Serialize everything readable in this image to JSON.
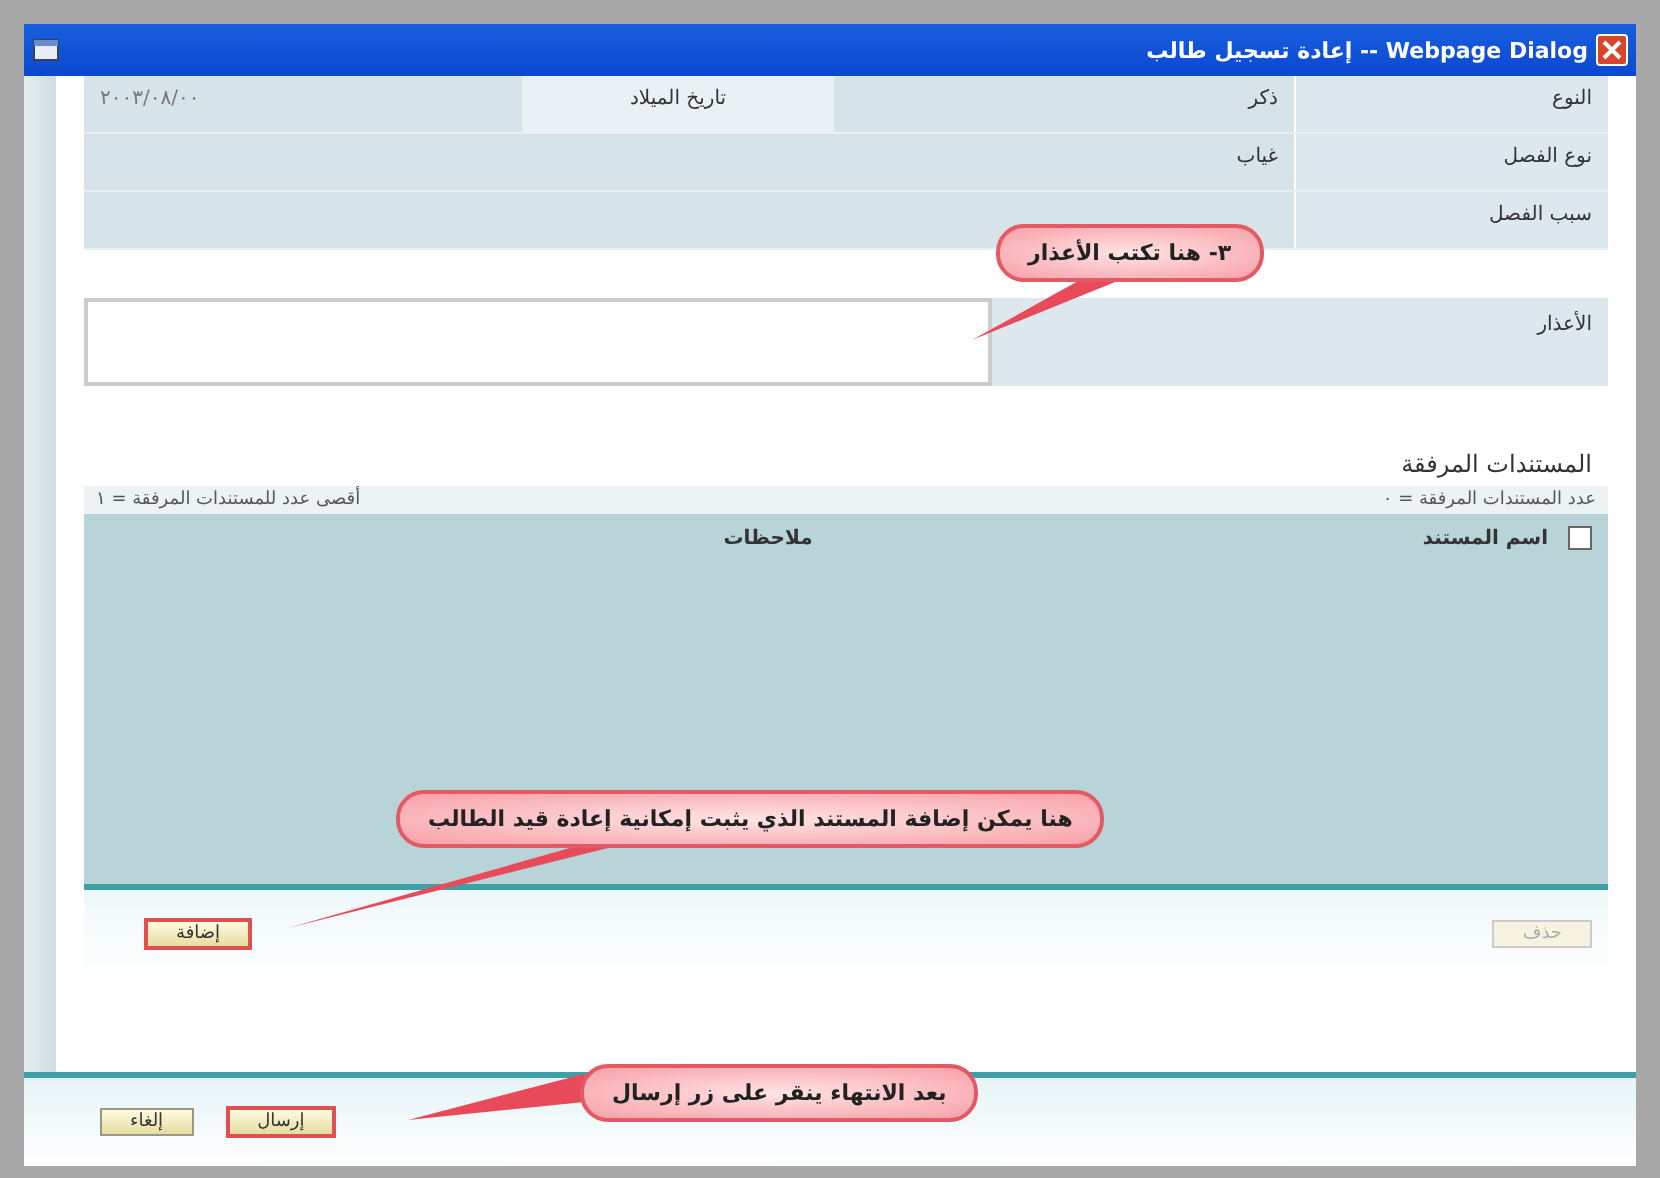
{
  "window": {
    "title": "إعادة تسجيل طالب -- Webpage Dialog"
  },
  "info_rows": [
    {
      "label": "النوع",
      "cells": [
        "ذكر",
        "تاريخ الميلاد",
        "٢٠٠٣/٠٨/٠٠"
      ]
    },
    {
      "label": "نوع الفصل",
      "cells": [
        "غياب"
      ]
    },
    {
      "label": "سبب الفصل",
      "cells": []
    }
  ],
  "excuse": {
    "label": "الأعذار"
  },
  "attachments": {
    "title": "المستندات المرفقة",
    "count": "عدد المستندات المرفقة = ٠",
    "max": "أقصى عدد للمستندات المرفقة = ١",
    "columns": [
      "اسم المستند",
      "ملاحظات"
    ],
    "select_all": {
      "checked": false
    },
    "delete_button": {
      "label": "حذف",
      "disabled": true
    },
    "add_button": {
      "label": "إضافة",
      "disabled": false
    }
  },
  "buttons": [
    {
      "label": "إرسال"
    },
    {
      "label": "إلغاء"
    }
  ],
  "callouts": [
    {
      "text": "٣- هنا تكتب الأعذار"
    },
    {
      "text": "هنا يمكن إضافة المستند الذي يثبت إمكانية إعادة قيد الطالب"
    },
    {
      "text": "بعد الانتهاء ينقر على زر إرسال"
    }
  ]
}
